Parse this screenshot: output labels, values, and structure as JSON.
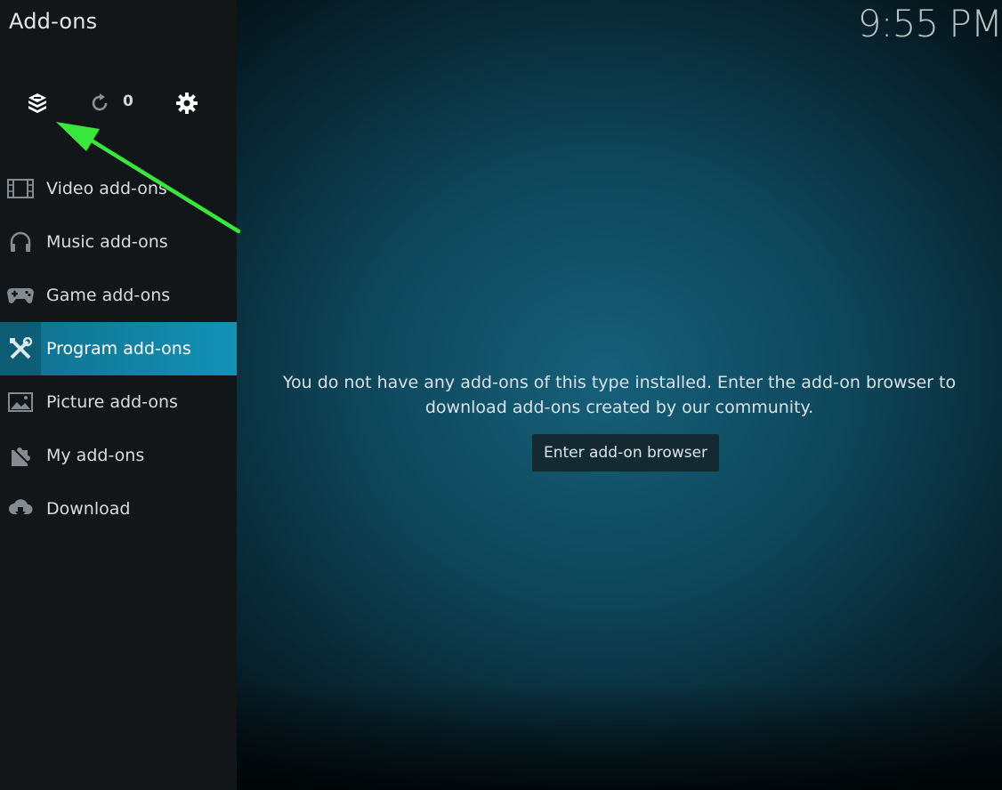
{
  "window": {
    "title": "Add-ons",
    "clock": "9:55 PM"
  },
  "toolbar": {
    "addon_browser_icon": "addon-box-icon",
    "updates_icon": "refresh-icon",
    "updates_count": "0",
    "settings_icon": "gear-icon"
  },
  "sidebar": {
    "items": [
      {
        "label": "Video add-ons",
        "icon": "film-icon",
        "active": false
      },
      {
        "label": "Music add-ons",
        "icon": "headphones-icon",
        "active": false
      },
      {
        "label": "Game add-ons",
        "icon": "gamepad-icon",
        "active": false
      },
      {
        "label": "Program add-ons",
        "icon": "tools-icon",
        "active": true
      },
      {
        "label": "Picture add-ons",
        "icon": "picture-icon",
        "active": false
      },
      {
        "label": "My add-ons",
        "icon": "puzzle-icon",
        "active": false
      },
      {
        "label": "Download",
        "icon": "cloud-download-icon",
        "active": false
      }
    ]
  },
  "main": {
    "message_line1": "You do not have any add-ons of this type installed. Enter the add-on browser to",
    "message_line2": "download add-ons created by our community.",
    "browser_button": "Enter add-on browser"
  },
  "colors": {
    "accent": "#1392b6",
    "sidebar_bg": "#121619",
    "annotation_arrow": "#37e83b"
  }
}
